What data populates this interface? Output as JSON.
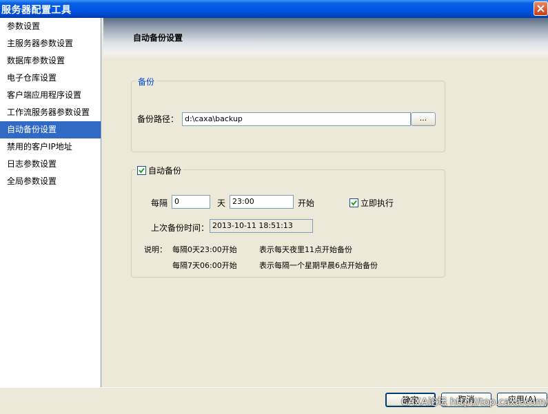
{
  "window": {
    "title": "服务器配置工具"
  },
  "sidebar": {
    "items": [
      {
        "label": "参数设置",
        "selected": false
      },
      {
        "label": "主服务器参数设置",
        "selected": false
      },
      {
        "label": "数据库参数设置",
        "selected": false
      },
      {
        "label": "电子仓库设置",
        "selected": false
      },
      {
        "label": "客户端应用程序设置",
        "selected": false
      },
      {
        "label": "工作流服务器参数设置",
        "selected": false
      },
      {
        "label": "自动备份设置",
        "selected": true
      },
      {
        "label": "禁用的客户IP地址",
        "selected": false
      },
      {
        "label": "日志参数设置",
        "selected": false
      },
      {
        "label": "全局参数设置",
        "selected": false
      }
    ]
  },
  "main": {
    "title": "自动备份设置",
    "backup_group": {
      "legend": "备份",
      "path_label": "备份路径：",
      "path_value": "d:\\caxa\\backup",
      "browse_label": "..."
    },
    "auto_group": {
      "legend": "自动备份",
      "enabled": true,
      "every_label": "每隔",
      "every_value": "0",
      "day_label": "天",
      "time_value": "23:00",
      "start_label": "开始",
      "run_now_label": "立即执行",
      "run_now_checked": true,
      "last_time_label": "上次备份时间：",
      "last_time_value": "2013-10-11 18:51:13",
      "note_label": "说明：",
      "notes": [
        {
          "example": "每隔0天23:00开始",
          "meaning": "表示每天夜里11点开始备份"
        },
        {
          "example": "每隔7天06:00开始",
          "meaning": "表示每隔一个星期早晨6点开始备份"
        }
      ]
    }
  },
  "buttons": {
    "ok": "确定",
    "cancel": "取消",
    "apply": "应用(A)"
  },
  "watermark": "CAXA论坛 http://top.caxa.com/",
  "colors": {
    "titlebar": "#0055e5",
    "selection": "#316ac5",
    "legend": "#0046d5",
    "background": "#ece9d8"
  }
}
